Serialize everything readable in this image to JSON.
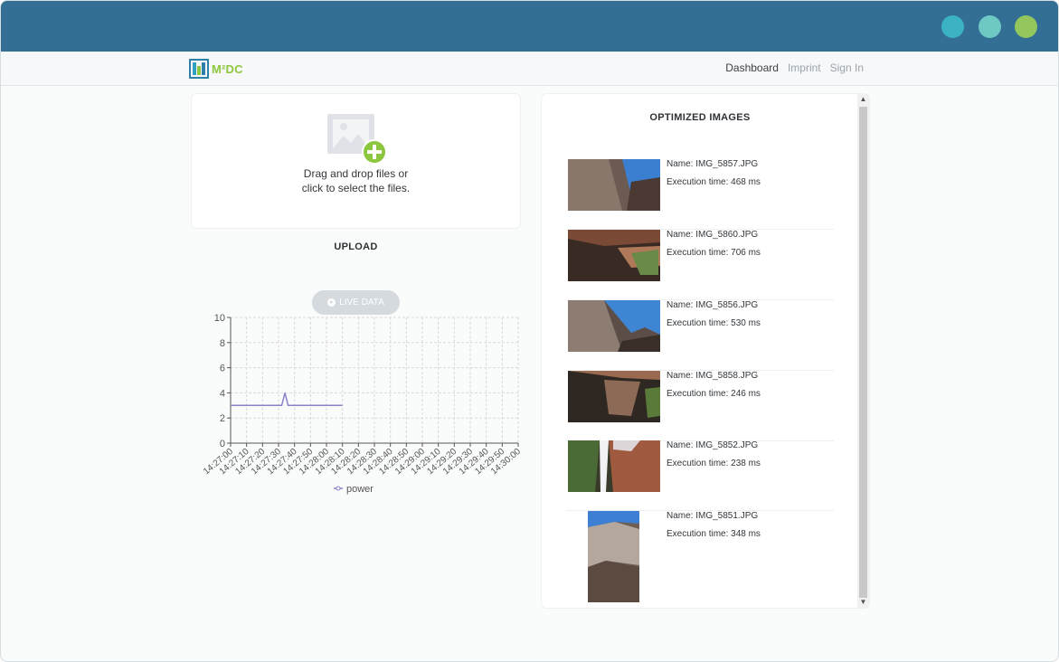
{
  "window": {
    "colors": {
      "titlebar": "#336e94",
      "dot1": "#3bb3c3",
      "dot2": "#6ec9c4",
      "dot3": "#93c75e"
    }
  },
  "nav": {
    "logo_text": "M²DC",
    "links": [
      "Dashboard",
      "Imprint",
      "Sign In"
    ]
  },
  "upload": {
    "line1": "Drag and drop files or",
    "line2": "click to select the files.",
    "heading": "UPLOAD"
  },
  "live_button": {
    "label": "LIVE DATA"
  },
  "chart_data": {
    "type": "line",
    "y_ticks": [
      "0",
      "2",
      "4",
      "6",
      "8",
      "10"
    ],
    "ylim": [
      0,
      10
    ],
    "x_ticks": [
      "14:27:00",
      "14:27:10",
      "14:27:20",
      "14:27:30",
      "14:27:40",
      "14:27:50",
      "14:28:00",
      "14:28:10",
      "14:28:20",
      "14:28:30",
      "14:28:40",
      "14:28:50",
      "14:29:00",
      "14:29:10",
      "14:29:20",
      "14:29:30",
      "14:29:40",
      "14:29:50",
      "14:30:00"
    ],
    "series": [
      {
        "name": "power",
        "color": "#8b82c9",
        "points": [
          [
            "14:27:00",
            3
          ],
          [
            "14:27:10",
            3
          ],
          [
            "14:27:20",
            3
          ],
          [
            "14:27:30",
            3
          ],
          [
            "14:27:32",
            3
          ],
          [
            "14:27:34",
            4
          ],
          [
            "14:27:36",
            3
          ],
          [
            "14:27:40",
            3
          ],
          [
            "14:27:50",
            3
          ],
          [
            "14:28:00",
            3
          ],
          [
            "14:28:10",
            3
          ]
        ]
      }
    ],
    "grid": true,
    "legend": "bottom"
  },
  "images": {
    "heading": "OPTIMIZED IMAGES",
    "items": [
      {
        "name": "Name: IMG_5857.JPG",
        "time": "Execution time: 468 ms"
      },
      {
        "name": "Name: IMG_5860.JPG",
        "time": "Execution time: 706 ms"
      },
      {
        "name": "Name: IMG_5856.JPG",
        "time": "Execution time: 530 ms"
      },
      {
        "name": "Name: IMG_5858.JPG",
        "time": "Execution time: 246 ms"
      },
      {
        "name": "Name: IMG_5852.JPG",
        "time": "Execution time: 238 ms"
      },
      {
        "name": "Name: IMG_5851.JPG",
        "time": "Execution time: 348 ms"
      }
    ]
  }
}
